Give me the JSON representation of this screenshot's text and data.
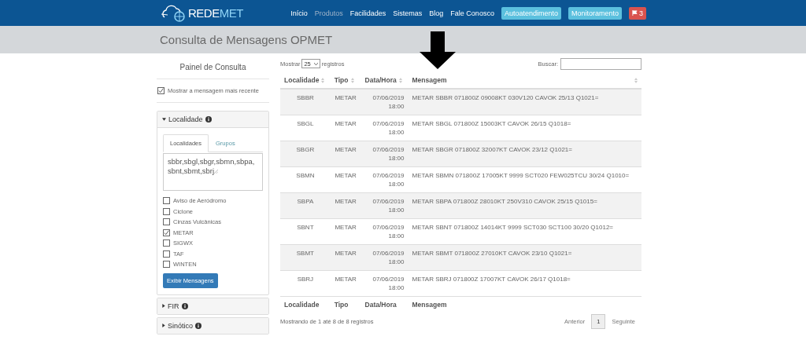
{
  "navbar": {
    "logo": [
      "REDE",
      "MET"
    ],
    "links": [
      {
        "label": "Início",
        "selected": false
      },
      {
        "label": "Produtos",
        "selected": true
      },
      {
        "label": "Facilidades",
        "selected": false
      },
      {
        "label": "Sistemas",
        "selected": false
      },
      {
        "label": "Blog",
        "selected": false
      },
      {
        "label": "Fale Conosco",
        "selected": false
      }
    ],
    "buttons": [
      "Autoatendimento",
      "Monitoramento"
    ],
    "alert_count": "3"
  },
  "page_title": "Consulta de Mensagens OPMET",
  "sidebar": {
    "title": "Painel de Consulta",
    "latest_only": {
      "label": "Mostrar a mensagem mais recente",
      "checked": true
    },
    "sections": [
      {
        "title": "Localidade",
        "expanded": true,
        "tabs": [
          {
            "label": "Localidades",
            "selected": true
          },
          {
            "label": "Grupos",
            "selected": false
          }
        ],
        "locations": "sbbr,sbgl,sbgr,sbmn,sbpa,sbnt,sbmt,sbrj",
        "types": [
          {
            "label": "Aviso de Aeródromo",
            "checked": false
          },
          {
            "label": "Ciclone",
            "checked": false
          },
          {
            "label": "Cinzas Vulcânicas",
            "checked": false
          },
          {
            "label": "METAR",
            "checked": true
          },
          {
            "label": "SIGWX",
            "checked": false
          },
          {
            "label": "TAF",
            "checked": false
          },
          {
            "label": "WINTEN",
            "checked": false
          }
        ],
        "submit": "Exibir Mensagens"
      },
      {
        "title": "FIR",
        "expanded": false
      },
      {
        "title": "Sinótico",
        "expanded": false
      }
    ]
  },
  "table": {
    "show_label": "Mostrar",
    "page_size": "25",
    "records_label": "registros",
    "search_label": "Buscar:",
    "columns": [
      "Localidade",
      "Tipo",
      "Data/Hora",
      "Mensagem"
    ],
    "rows": [
      [
        "SBBR",
        "METAR",
        "07/06/2019 18:00",
        "METAR SBBR 071800Z 09008KT 030V120 CAVOK 25/13 Q1021="
      ],
      [
        "SBGL",
        "METAR",
        "07/06/2019 18:00",
        "METAR SBGL 071800Z 15003KT CAVOK 26/15 Q1018="
      ],
      [
        "SBGR",
        "METAR",
        "07/06/2019 18:00",
        "METAR SBGR 071800Z 32007KT CAVOK 23/12 Q1021="
      ],
      [
        "SBMN",
        "METAR",
        "07/06/2019 18:00",
        "METAR SBMN 071800Z 17005KT 9999 SCT020 FEW025TCU 30/24 Q1010="
      ],
      [
        "SBPA",
        "METAR",
        "07/06/2019 18:00",
        "METAR SBPA 071800Z 28010KT 250V310 CAVOK 25/15 Q1015="
      ],
      [
        "SBNT",
        "METAR",
        "07/06/2019 18:00",
        "METAR SBNT 071800Z 14014KT 9999 SCT030 SCT100 30/20 Q1012="
      ],
      [
        "SBMT",
        "METAR",
        "07/06/2019 18:00",
        "METAR SBMT 071800Z 27010KT CAVOK 23/10 Q1021="
      ],
      [
        "SBRJ",
        "METAR",
        "07/06/2019 18:00",
        "METAR SBRJ 071800Z 17007KT CAVOK 26/17 Q1018="
      ]
    ],
    "footer_columns": [
      "Localidade",
      "Tipo",
      "Data/Hora",
      "Mensagem"
    ],
    "info": "Mostrando de 1 até 8 de 8 registros",
    "pagination": [
      {
        "label": "Anterior",
        "selected": false
      },
      {
        "label": "1",
        "selected": true
      },
      {
        "label": "Seguinte",
        "selected": false
      }
    ]
  }
}
